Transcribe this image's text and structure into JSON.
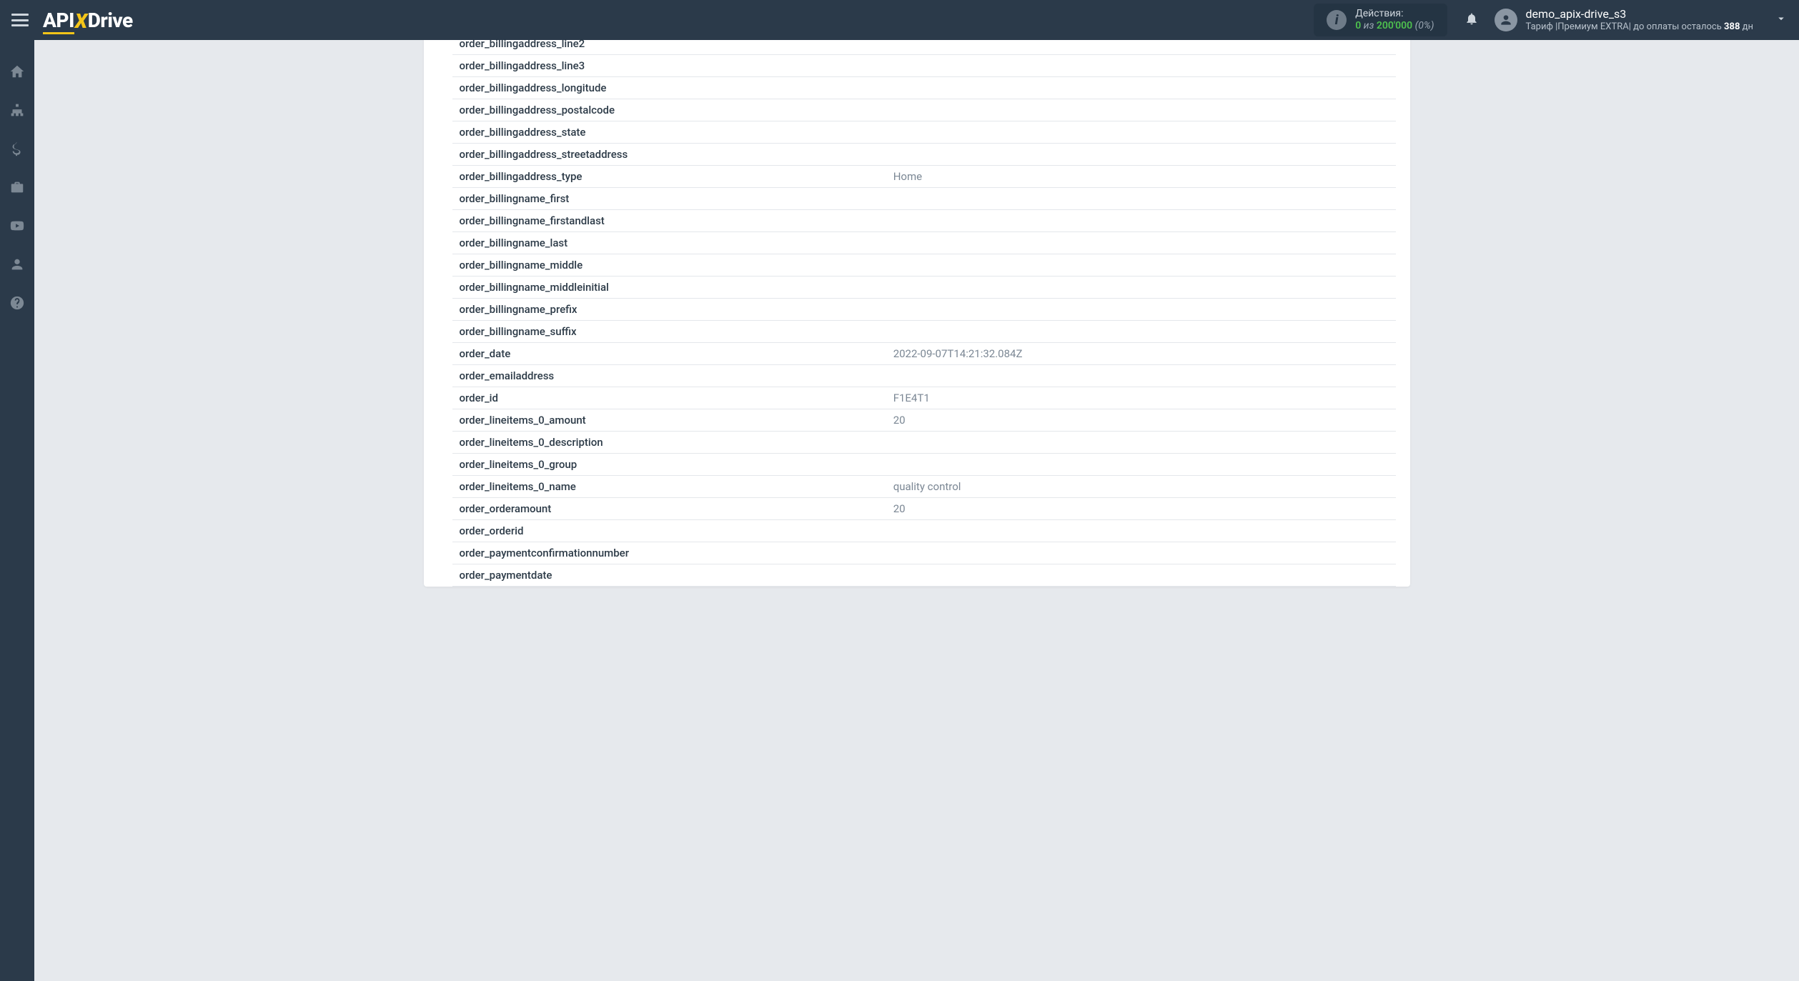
{
  "header": {
    "logo": {
      "api": "API",
      "x": "X",
      "drive": "Drive"
    },
    "actions": {
      "label": "Действия:",
      "zero": "0",
      "of": " из ",
      "max": "200'000",
      "pct": " (0%)"
    },
    "user": {
      "name": "demo_apix-drive_s3",
      "tariff_prefix": "Тариф |",
      "tariff_name": "Премиум EXTRA",
      "tariff_sep": "| до оплаты осталось ",
      "days": "388",
      "days_suffix": " дн"
    }
  },
  "fields": [
    {
      "key": "order_billingaddress_line2",
      "val": ""
    },
    {
      "key": "order_billingaddress_line3",
      "val": ""
    },
    {
      "key": "order_billingaddress_longitude",
      "val": ""
    },
    {
      "key": "order_billingaddress_postalcode",
      "val": ""
    },
    {
      "key": "order_billingaddress_state",
      "val": ""
    },
    {
      "key": "order_billingaddress_streetaddress",
      "val": ""
    },
    {
      "key": "order_billingaddress_type",
      "val": "Home"
    },
    {
      "key": "order_billingname_first",
      "val": ""
    },
    {
      "key": "order_billingname_firstandlast",
      "val": ""
    },
    {
      "key": "order_billingname_last",
      "val": ""
    },
    {
      "key": "order_billingname_middle",
      "val": ""
    },
    {
      "key": "order_billingname_middleinitial",
      "val": ""
    },
    {
      "key": "order_billingname_prefix",
      "val": ""
    },
    {
      "key": "order_billingname_suffix",
      "val": ""
    },
    {
      "key": "order_date",
      "val": "2022-09-07T14:21:32.084Z"
    },
    {
      "key": "order_emailaddress",
      "val": ""
    },
    {
      "key": "order_id",
      "val": "F1E4T1"
    },
    {
      "key": "order_lineitems_0_amount",
      "val": "20"
    },
    {
      "key": "order_lineitems_0_description",
      "val": ""
    },
    {
      "key": "order_lineitems_0_group",
      "val": ""
    },
    {
      "key": "order_lineitems_0_name",
      "val": "quality control"
    },
    {
      "key": "order_orderamount",
      "val": "20"
    },
    {
      "key": "order_orderid",
      "val": ""
    },
    {
      "key": "order_paymentconfirmationnumber",
      "val": ""
    },
    {
      "key": "order_paymentdate",
      "val": ""
    }
  ],
  "sidenav": [
    "home-icon",
    "sitemap-icon",
    "dollar-icon",
    "briefcase-icon",
    "youtube-icon",
    "user-icon",
    "help-icon"
  ]
}
